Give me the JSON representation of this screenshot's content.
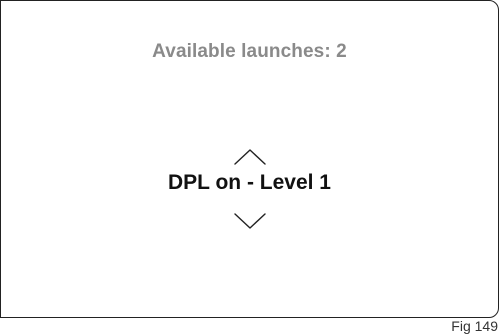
{
  "screen": {
    "status_text": "Available launches: 2",
    "selector": {
      "up_icon": "chevron-up-icon",
      "value": "DPL on - Level 1",
      "down_icon": "chevron-down-icon"
    }
  },
  "figure_label": "Fig 149",
  "colors": {
    "status_text": "#8a8a8a",
    "value_text": "#111111",
    "frame": "#222222"
  }
}
